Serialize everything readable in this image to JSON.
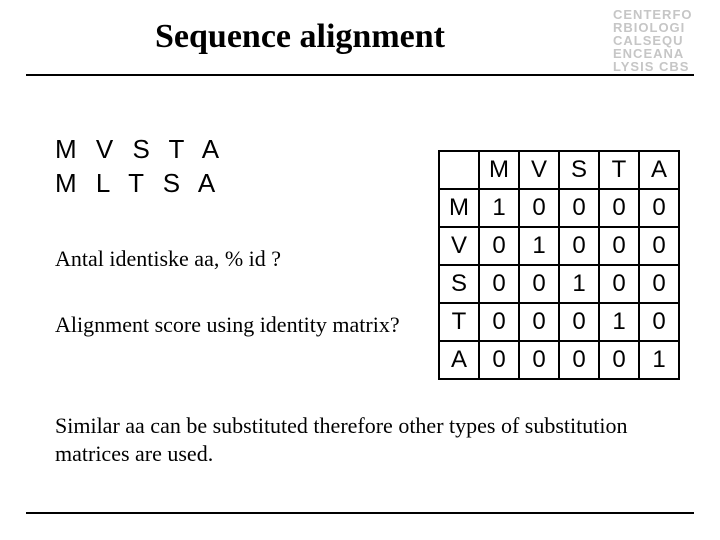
{
  "title": "Sequence alignment",
  "logo_text": "CENTERFO\nRBIOLOGI\nCALSEQU\nENCEANA\nLYSIS CBS",
  "sequence_line_1": "M V S T A",
  "sequence_line_2": "M L T S A",
  "question_1": "Antal identiske aa, % id ?",
  "question_2": "Alignment score using identity matrix?",
  "footer_note": "Similar aa can be substituted therefore other types of substitution matrices are used.",
  "matrix": {
    "col_headers": [
      "M",
      "V",
      "S",
      "T",
      "A"
    ],
    "row_headers": [
      "M",
      "V",
      "S",
      "T",
      "A"
    ],
    "values": [
      [
        1,
        0,
        0,
        0,
        0
      ],
      [
        0,
        1,
        0,
        0,
        0
      ],
      [
        0,
        0,
        1,
        0,
        0
      ],
      [
        0,
        0,
        0,
        1,
        0
      ],
      [
        0,
        0,
        0,
        0,
        1
      ]
    ]
  }
}
